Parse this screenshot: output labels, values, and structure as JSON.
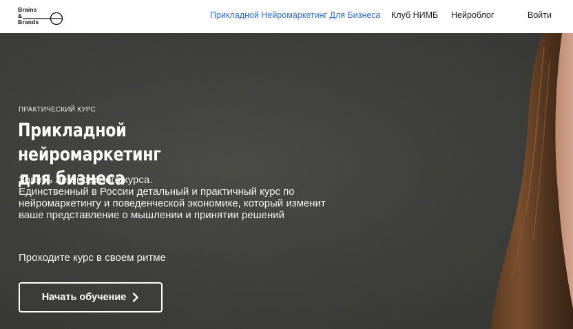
{
  "header": {
    "logo": {
      "line1": "Brains",
      "line2": "&",
      "line3": "Brands"
    },
    "nav": [
      {
        "label": "Прикладной Нейромаркетинг Для Бизнеса",
        "active": true
      },
      {
        "label": "Клуб НИМБ",
        "active": false
      },
      {
        "label": "Нейроблог",
        "active": false
      }
    ],
    "login_label": "Войти"
  },
  "hero": {
    "kicker": "ПРАКТИЧЕСКИЙ КУРС",
    "title_line1": "Прикладной нейромаркетинг",
    "title_line2": "для бизнеса",
    "desc_line1": "Запись легендарного курса.",
    "desc_line2": "Единственный в России детальный и практичный курс по нейромаркетингу и поведенческой экономике, который изменит ваше представление о мышлении и принятии решений",
    "rhythm": "Проходите курс в своем ритме",
    "cta_label": "Начать обучение",
    "cta_icon": "chevron-right-icon"
  },
  "colors": {
    "accent": "#2f6fd6",
    "hero_bg": "#3f3f3c",
    "text_on_dark": "#ffffff"
  }
}
